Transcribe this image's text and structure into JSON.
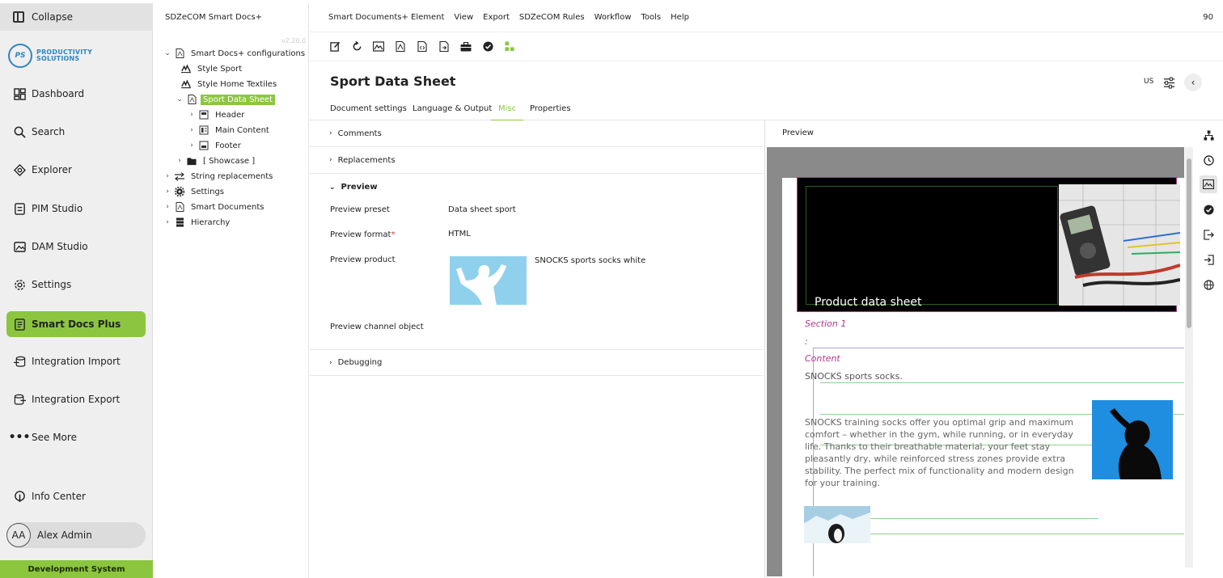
{
  "nav": {
    "collapse_label": "Collapse",
    "logo_text_line1": "PRODUCTIVITY",
    "logo_text_line2": "SOLUTIONS",
    "logo_mark": "PS",
    "items": [
      {
        "label": "Dashboard",
        "icon": "dashboard-icon"
      },
      {
        "label": "Search",
        "icon": "search-icon"
      },
      {
        "label": "Explorer",
        "icon": "explorer-icon"
      },
      {
        "label": "PIM Studio",
        "icon": "pim-studio-icon"
      },
      {
        "label": "DAM Studio",
        "icon": "image-icon"
      },
      {
        "label": "Settings",
        "icon": "gear-icon"
      },
      {
        "label": "Smart Docs Plus",
        "icon": "document-icon",
        "active": true
      },
      {
        "label": "Integration Import",
        "icon": "import-icon"
      },
      {
        "label": "Integration Export",
        "icon": "export-icon"
      },
      {
        "label": "See More",
        "icon": "more-icon"
      }
    ],
    "info_center": "Info Center",
    "user_initials": "AA",
    "user_name": "Alex Admin",
    "environment": "Development System",
    "accent_color": "#8cc63f"
  },
  "tree": {
    "title": "SDZeCOM Smart Docs+",
    "version": "v2.20.0",
    "nodes": [
      {
        "label": "Smart Docs+ configurations",
        "expanded": true
      },
      {
        "label": "Style Sport"
      },
      {
        "label": "Style Home Textiles"
      },
      {
        "label": "Sport Data Sheet",
        "selected": true,
        "expanded": true
      },
      {
        "label": "Header"
      },
      {
        "label": "Main Content"
      },
      {
        "label": "Footer"
      },
      {
        "label": "[ Showcase ]"
      },
      {
        "label": "String replacements"
      },
      {
        "label": "Settings"
      },
      {
        "label": "Smart Documents"
      },
      {
        "label": "Hierarchy"
      }
    ]
  },
  "menu": {
    "items": [
      "Smart Documents+ Element",
      "View",
      "Export",
      "SDZeCOM Rules",
      "Workflow",
      "Tools",
      "Help"
    ],
    "count": "90"
  },
  "document": {
    "title": "Sport Data Sheet",
    "locale": "US"
  },
  "tabs": [
    "Document settings",
    "Language & Output",
    "Misc",
    "Properties"
  ],
  "active_tab": "Misc",
  "sections": {
    "comments": "Comments",
    "replacements": "Replacements",
    "preview": "Preview",
    "debugging": "Debugging"
  },
  "fields": {
    "preset_label": "Preview preset",
    "preset_value": "Data sheet sport",
    "format_label": "Preview format",
    "format_required": "*",
    "format_value": "HTML",
    "product_label": "Preview product",
    "product_value": "SNOCKS sports socks white",
    "channel_label": "Preview channel object"
  },
  "preview": {
    "title": "Preview",
    "banner_title": "Product data sheet",
    "section_title": "Section 1",
    "colon": ":",
    "content_label": "Content",
    "content_text": "SNOCKS sports socks.",
    "long_text": "SNOCKS training socks offer you optimal grip and maximum comfort – whether in the gym, while running, or in everyday life. Thanks to their breathable material, your feet stay pleasantly dry, while reinforced stress zones provide extra stability. The perfect mix of functionality and modern design for your training."
  }
}
